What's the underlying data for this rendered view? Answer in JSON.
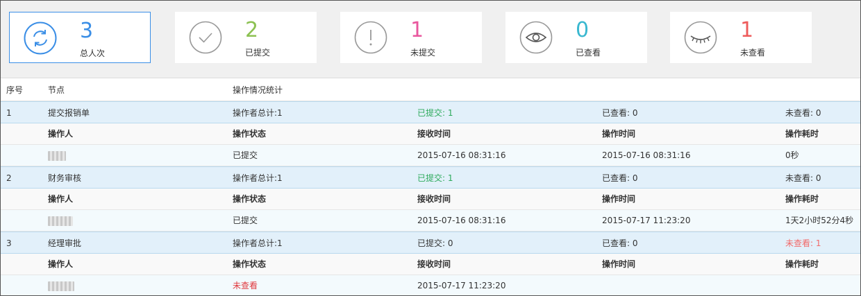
{
  "stats": [
    {
      "value": "3",
      "label": "总人次",
      "color": "#3a8ee6",
      "icon": "refresh-icon"
    },
    {
      "value": "2",
      "label": "已提交",
      "color": "#8cc152",
      "icon": "check-circle-icon"
    },
    {
      "value": "1",
      "label": "未提交",
      "color": "#e9579e",
      "icon": "exclamation-circle-icon"
    },
    {
      "value": "0",
      "label": "已查看",
      "color": "#3ab8d0",
      "icon": "eye-icon"
    },
    {
      "value": "1",
      "label": "未查看",
      "color": "#ee5b5b",
      "icon": "eye-closed-icon"
    }
  ],
  "table": {
    "headers": {
      "seq": "序号",
      "node": "节点",
      "stats": "操作情况统计"
    },
    "sub_headers": {
      "operator": "操作人",
      "status": "操作状态",
      "received": "接收时间",
      "operated": "操作时间",
      "duration": "操作耗时"
    },
    "nodes": [
      {
        "seq": "1",
        "name": "提交报销单",
        "total": "操作者总计:1",
        "submitted": "已提交: 1",
        "viewed": "已查看: 0",
        "not_viewed": "未查看: 0",
        "rows": [
          {
            "operator": "",
            "status": "已提交",
            "received": "2015-07-16 08:31:16",
            "operated": "2015-07-16 08:31:16",
            "duration": "0秒"
          }
        ]
      },
      {
        "seq": "2",
        "name": "财务审核",
        "total": "操作者总计:1",
        "submitted": "已提交: 1",
        "viewed": "已查看: 0",
        "not_viewed": "未查看: 0",
        "rows": [
          {
            "operator": "",
            "status": "已提交",
            "received": "2015-07-16 08:31:16",
            "operated": "2015-07-17 11:23:20",
            "duration": "1天2小时52分4秒"
          }
        ]
      },
      {
        "seq": "3",
        "name": "经理审批",
        "total": "操作者总计:1",
        "submitted": "已提交: 0",
        "viewed": "已查看: 0",
        "not_viewed": "未查看: 1",
        "rows": [
          {
            "operator": "",
            "status": "未查看",
            "received": "2015-07-17 11:23:20",
            "operated": "",
            "duration": ""
          }
        ]
      }
    ]
  }
}
